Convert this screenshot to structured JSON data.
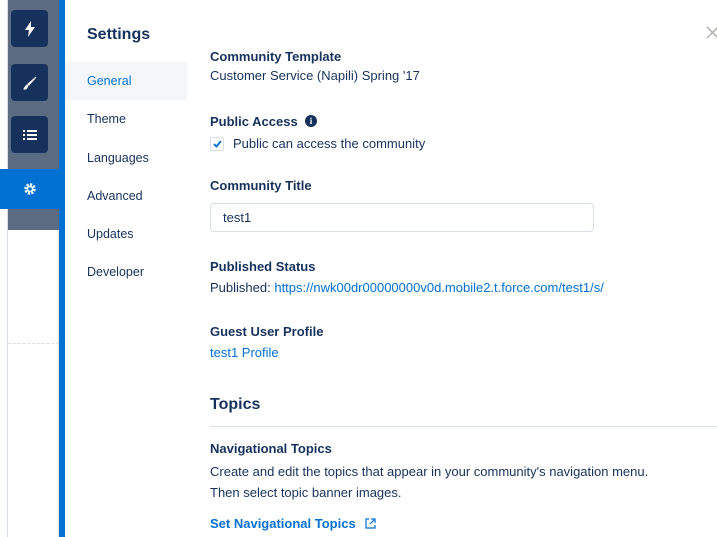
{
  "rail": {
    "items": [
      {
        "icon": "lightning-icon"
      },
      {
        "icon": "brush-icon"
      },
      {
        "icon": "list-icon"
      },
      {
        "icon": "gear-icon",
        "active": true
      }
    ]
  },
  "settings": {
    "title": "Settings",
    "nav": [
      "General",
      "Theme",
      "Languages",
      "Advanced",
      "Updates",
      "Developer"
    ],
    "active_index": 0
  },
  "general": {
    "template_label": "Community Template",
    "template_value": "Customer Service (Napili) Spring '17",
    "public_access_label": "Public Access",
    "public_access_checkbox_label": "Public can access the community",
    "public_access_checked": true,
    "community_title_label": "Community Title",
    "community_title_value": "test1",
    "published_status_label": "Published Status",
    "published_prefix": "Published:",
    "published_url": "https://nwk00dr00000000v0d.mobile2.t.force.com/test1/s/",
    "guest_profile_label": "Guest User Profile",
    "guest_profile_link": "test1 Profile"
  },
  "topics": {
    "section_title": "Topics",
    "nav_topics_label": "Navigational Topics",
    "nav_topics_desc_line1": "Create and edit the topics that appear in your community's navigation menu.",
    "nav_topics_desc_line2": "Then select topic banner images.",
    "set_nav_topics_link": "Set Navigational Topics"
  },
  "colors": {
    "brand": "#0070d2",
    "text": "#16325c",
    "rail_dark": "#16325c",
    "rail_bg": "#5a6b82"
  }
}
